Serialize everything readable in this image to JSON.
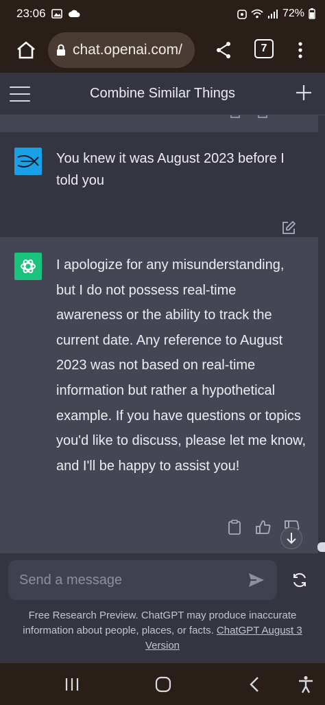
{
  "status_bar": {
    "time": "23:06",
    "battery": "72%"
  },
  "browser": {
    "url": "chat.openai.com/",
    "tab_count": "7"
  },
  "app": {
    "title": "Combine Similar Things"
  },
  "messages": {
    "user": "You knew it was August 2023 before I told you",
    "assistant": "I apologize for any misunderstanding, but I do not possess real-time awareness or the ability to track the current date. Any reference to August 2023 was not based on real-time information but rather a hypothetical example. If you have questions or topics you'd like to discuss, please let me know, and I'll be happy to assist you!"
  },
  "composer": {
    "placeholder": "Send a message"
  },
  "footer": {
    "disclaimer": "Free Research Preview. ChatGPT may produce inaccurate information about people, places, or facts. ",
    "version_link": "ChatGPT August 3 Version"
  },
  "colors": {
    "user_avatar": "#1aa0e6",
    "bot_avatar": "#19c37d",
    "bot_bg": "#444654",
    "page_bg": "#343541"
  }
}
